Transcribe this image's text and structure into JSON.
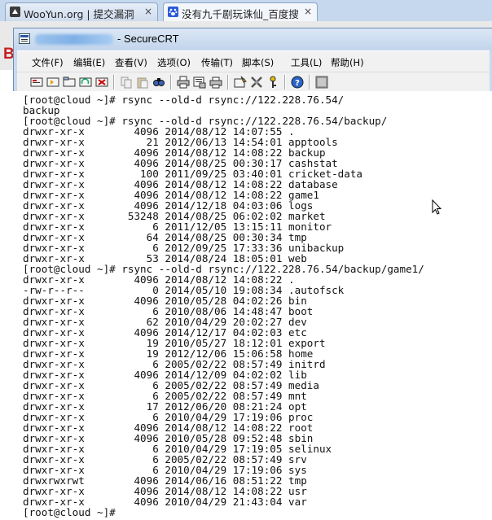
{
  "browser": {
    "tabs": [
      {
        "label": "WooYun.org | 提交漏洞",
        "close": "×",
        "icon": "wooyun-favicon"
      },
      {
        "label": "没有九千剧玩诛仙_百度搜",
        "close": "×",
        "icon": "baidu-paw-icon"
      }
    ]
  },
  "background_glyph": "B",
  "window": {
    "title": "- SecureCRT",
    "icon": "securecrt-app-icon"
  },
  "menu": [
    "文件(F)",
    "编辑(E)",
    "查看(V)",
    "选项(O)",
    "传输(T)",
    "脚本(S)",
    "工具(L)",
    "帮助(H)"
  ],
  "toolbar": {
    "buttons": [
      "connect-icon",
      "quick-connect-icon",
      "connect-tab-icon",
      "reconnect-icon",
      "disconnect-icon",
      "copy-icon",
      "paste-icon",
      "find-icon",
      "print-icon",
      "print-setup-icon",
      "print-screen-icon",
      "session-options-icon",
      "global-options-icon",
      "keymap-icon",
      "help-icon",
      "about-icon"
    ]
  },
  "terminal": {
    "lines": [
      "[root@cloud ~]# rsync --old-d rsync://122.228.76.54/",
      "backup",
      "[root@cloud ~]# rsync --old-d rsync://122.228.76.54/backup/",
      "drwxr-xr-x        4096 2014/08/12 14:07:55 .",
      "drwxr-xr-x          21 2012/06/13 14:54:01 apptools",
      "drwxr-xr-x        4096 2014/08/12 14:08:22 backup",
      "drwxr-xr-x        4096 2014/08/25 00:30:17 cashstat",
      "drwxr-xr-x         100 2011/09/25 03:40:01 cricket-data",
      "drwxr-xr-x        4096 2014/08/12 14:08:22 database",
      "drwxr-xr-x        4096 2014/08/12 14:08:22 game1",
      "drwxr-xr-x        4096 2014/12/18 04:03:06 logs",
      "drwxr-xr-x       53248 2014/08/25 06:02:02 market",
      "drwxr-xr-x           6 2011/12/05 13:15:11 monitor",
      "drwxr-xr-x          64 2014/08/25 00:30:34 tmp",
      "drwxr-xr-x           6 2012/09/25 17:33:36 unibackup",
      "drwxr-xr-x          53 2014/08/24 18:05:01 web",
      "[root@cloud ~]# rsync --old-d rsync://122.228.76.54/backup/game1/",
      "drwxr-xr-x        4096 2014/08/12 14:08:22 .",
      "-rw-r--r--           0 2014/05/10 19:08:34 .autofsck",
      "drwxr-xr-x        4096 2010/05/28 04:02:26 bin",
      "drwxr-xr-x           6 2010/08/06 14:48:47 boot",
      "drwxr-xr-x          62 2010/04/29 20:02:27 dev",
      "drwxr-xr-x        4096 2014/12/17 04:02:03 etc",
      "drwxr-xr-x          19 2010/05/27 18:12:01 export",
      "drwxr-xr-x          19 2012/12/06 15:06:58 home",
      "drwxr-xr-x           6 2005/02/22 08:57:49 initrd",
      "drwxr-xr-x        4096 2014/12/09 04:02:02 lib",
      "drwxr-xr-x           6 2005/02/22 08:57:49 media",
      "drwxr-xr-x           6 2005/02/22 08:57:49 mnt",
      "drwxr-xr-x          17 2012/06/20 08:21:24 opt",
      "drwxr-xr-x           6 2010/04/29 17:19:06 proc",
      "drwxr-xr-x        4096 2014/08/12 14:08:22 root",
      "drwxr-xr-x        4096 2010/05/28 09:52:48 sbin",
      "drwxr-xr-x           6 2010/04/29 17:19:05 selinux",
      "drwxr-xr-x           6 2005/02/22 08:57:49 srv",
      "drwxr-xr-x           6 2010/04/29 17:19:06 sys",
      "drwxrwxrwt        4096 2014/06/16 08:51:22 tmp",
      "drwxr-xr-x        4096 2014/08/12 14:08:22 usr",
      "drwxr-xr-x        4096 2010/04/29 21:43:04 var",
      "[root@cloud ~]# "
    ]
  },
  "cursor": "mouse-pointer-icon"
}
